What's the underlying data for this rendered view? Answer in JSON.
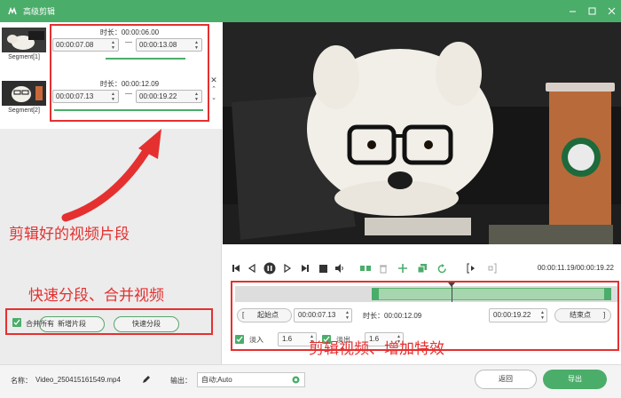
{
  "window": {
    "title": "高级剪辑"
  },
  "segments": [
    {
      "name": "Segment[1]",
      "duration": "时长：00:00:06.00",
      "start": "00:00:07.08",
      "end": "00:00:13.08"
    },
    {
      "name": "Segment[2]",
      "duration": "时长：00:00:12.09",
      "start": "00:00:07.13",
      "end": "00:00:19.22"
    }
  ],
  "annotations": {
    "clips": "剪辑好的视频片段",
    "split": "快速分段、合并视频",
    "edit": "剪辑视频、增加特效"
  },
  "left_actions": {
    "add_segment": "新增片段",
    "quick_split": "快速分段",
    "merge_all": "合并所有"
  },
  "player": {
    "timecode": "00:00:11.19/00:00:19.22"
  },
  "trim": {
    "start_point": "起始点",
    "start_time": "00:00:07.13",
    "duration": "时长：00:00:12.09",
    "end_time": "00:00:19.22",
    "end_point": "结束点"
  },
  "effects": {
    "fade_in_label": "淡入",
    "fade_in_value": "1.6",
    "fade_out_label": "淡出",
    "fade_out_value": "1.6"
  },
  "footer": {
    "name_label": "名称：",
    "file_name": "Video_250415161549.mp4",
    "output_label": "输出：",
    "output_value": "自动;Auto",
    "back": "返回",
    "export": "导出"
  },
  "colors": {
    "accent": "#4bad6a",
    "annotation": "#e53030"
  },
  "icons": [
    "app-logo-icon",
    "minimize-icon",
    "maximize-icon",
    "close-icon",
    "edit-icon",
    "gear-icon",
    "prev-icon",
    "step-back-icon",
    "pause-icon",
    "step-forward-icon",
    "stop-icon",
    "volume-icon",
    "split-icon",
    "delete-icon",
    "add-icon",
    "copy-icon",
    "rotate-icon",
    "mark-in-icon",
    "mark-out-icon"
  ]
}
